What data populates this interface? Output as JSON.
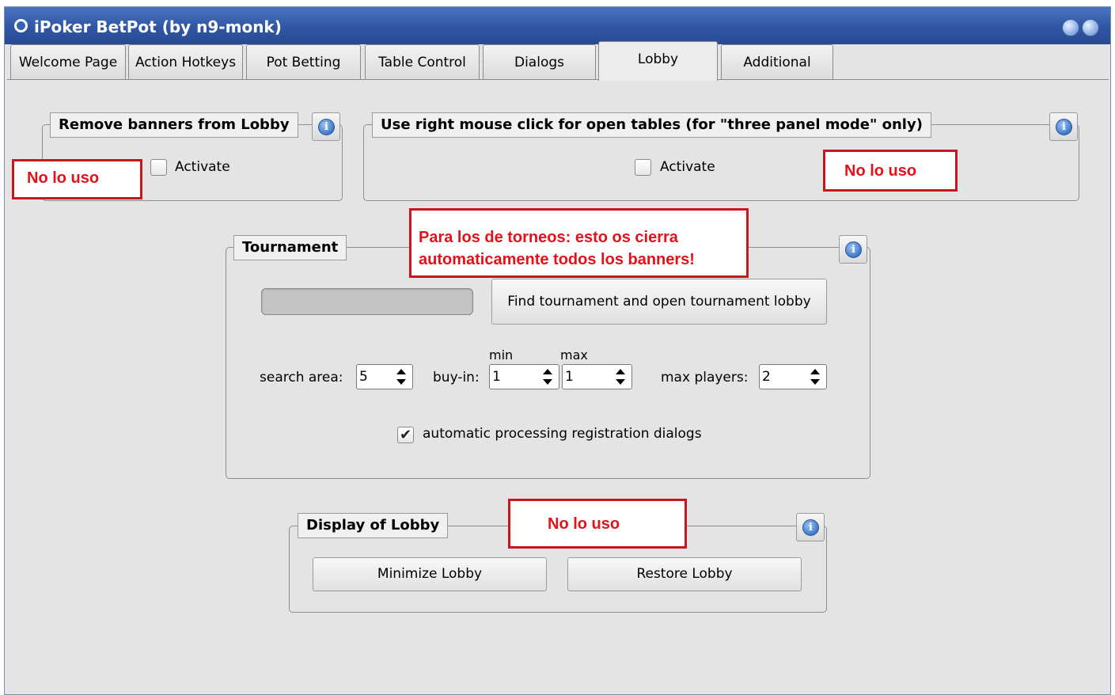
{
  "window": {
    "title": "iPoker BetPot (by n9-monk)",
    "icon": "app-logo-icon"
  },
  "tabs": [
    {
      "label": "Welcome Page",
      "active": false
    },
    {
      "label": "Action Hotkeys",
      "active": false
    },
    {
      "label": "Pot Betting",
      "active": false
    },
    {
      "label": "Table Control",
      "active": false
    },
    {
      "label": "Dialogs",
      "active": false
    },
    {
      "label": "Lobby",
      "active": true
    },
    {
      "label": "Additional",
      "active": false
    }
  ],
  "remove_banners": {
    "title": "Remove banners from Lobby",
    "checkbox_label": "Activate",
    "checked": false,
    "annotation": "No lo uso"
  },
  "right_click": {
    "title": "Use right mouse click for open tables (for \"three panel mode\" only)",
    "checkbox_label": "Activate",
    "checked": false,
    "annotation": "No lo uso"
  },
  "tournament": {
    "title": "Tournament",
    "annotation_line1": "Para los de torneos: esto os cierra",
    "annotation_line2": "automaticamente todos los banners!",
    "find_button": "Find tournament and open tournament lobby",
    "search_area_label": "search area:",
    "search_area_value": "5",
    "buyin_label": "buy-in:",
    "min_label": "min",
    "max_label": "max",
    "buyin_min_value": "1",
    "buyin_max_value": "1",
    "max_players_label": "max players:",
    "max_players_value": "2",
    "auto_checkbox_label": "automatic processing registration dialogs",
    "auto_checked": true
  },
  "display_lobby": {
    "title": "Display of Lobby",
    "annotation": "No lo uso",
    "minimize_button": "Minimize Lobby",
    "restore_button": "Restore Lobby"
  },
  "colors": {
    "titlebar": "#3056a4",
    "annotation_red": "#e3121a",
    "background": "#e4e4e4"
  }
}
